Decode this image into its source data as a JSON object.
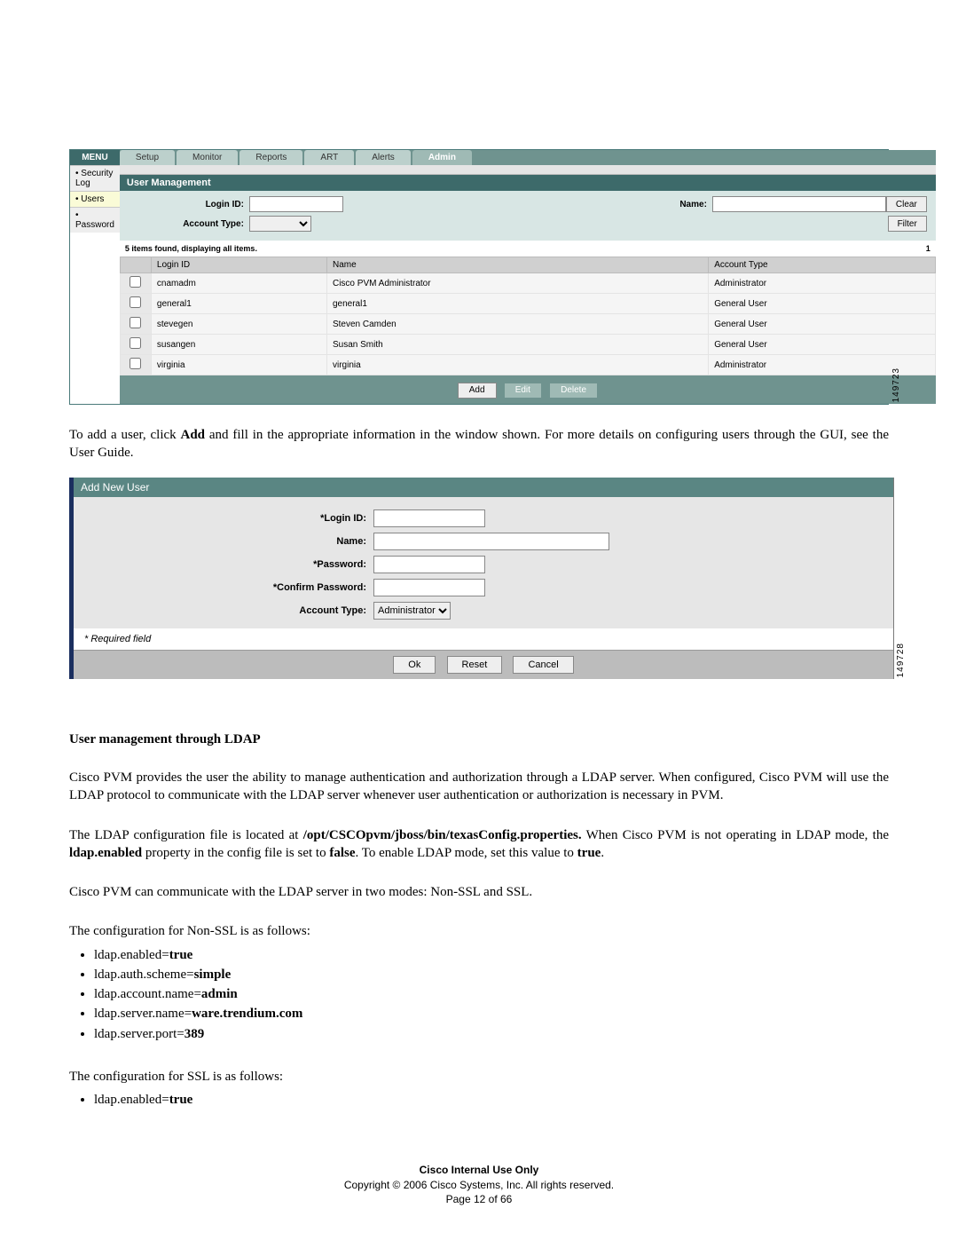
{
  "menu": {
    "header": "MENU",
    "items": [
      {
        "label": "Security Log",
        "selected": false
      },
      {
        "label": "Users",
        "selected": true
      },
      {
        "label": "Password",
        "selected": false
      }
    ]
  },
  "tabs": {
    "items": [
      "Setup",
      "Monitor",
      "Reports",
      "ART",
      "Alerts",
      "Admin"
    ],
    "active_index": 5
  },
  "user_mgmt": {
    "section_title": "User Management",
    "filters": {
      "login_id_label": "Login ID:",
      "name_label": "Name:",
      "account_type_label": "Account Type:",
      "clear_label": "Clear",
      "filter_label": "Filter"
    },
    "table": {
      "caption": "5 items found, displaying all items.",
      "page": "1",
      "cols": [
        "Login ID",
        "Name",
        "Account Type"
      ],
      "rows": [
        {
          "login": "cnamadm",
          "name": "Cisco PVM Administrator",
          "type": "Administrator"
        },
        {
          "login": "general1",
          "name": "general1",
          "type": "General User"
        },
        {
          "login": "stevegen",
          "name": "Steven Camden",
          "type": "General User"
        },
        {
          "login": "susangen",
          "name": "Susan Smith",
          "type": "General User"
        },
        {
          "login": "virginia",
          "name": "virginia",
          "type": "Administrator"
        }
      ]
    },
    "actions": {
      "add": "Add",
      "edit": "Edit",
      "delete": "Delete"
    },
    "image_id": "149723"
  },
  "body_text_1": "To add a user, click <b>Add</b> and fill in the appropriate information in the window shown. For more details on configuring users through the GUI, see the User Guide.",
  "add_user": {
    "title": "Add New User",
    "labels": {
      "login_id": "*Login ID:",
      "name": "Name:",
      "password": "*Password:",
      "confirm_password": "*Confirm Password:",
      "account_type": "Account Type:"
    },
    "account_type_value": "Administrator",
    "required_note": "* Required field",
    "buttons": {
      "ok": "Ok",
      "reset": "Reset",
      "cancel": "Cancel"
    },
    "image_id": "149728"
  },
  "ldap": {
    "heading": "User management through LDAP",
    "para1": "Cisco PVM provides the user the ability to manage authentication and authorization through a LDAP server. When configured, Cisco PVM will use the LDAP protocol to communicate with the LDAP server whenever user authentication or authorization is necessary in PVM.",
    "para2_a": "The LDAP configuration file is located at ",
    "para2_path": "/opt/CSCOpvm/jboss/bin/texasConfig.properties.",
    "para2_b": "  When Cisco PVM is not operating in LDAP mode, the ",
    "para2_prop": "ldap.enabled",
    "para2_c": " property in the config file is set to ",
    "para2_false": "false",
    "para2_d": ". To enable LDAP mode, set this value to ",
    "para2_true": "true",
    "para2_e": ".",
    "para3": "Cisco PVM can communicate with the LDAP server in two modes: Non-SSL and SSL.",
    "para4": "The configuration for Non-SSL is as follows:",
    "nonssl": [
      {
        "key": "ldap.enabled=",
        "val": "true"
      },
      {
        "key": "ldap.auth.scheme=",
        "val": "simple"
      },
      {
        "key": "ldap.account.name=",
        "val": "admin"
      },
      {
        "key": "ldap.server.name=",
        "val": "ware.trendium.com"
      },
      {
        "key": "ldap.server.port=",
        "val": "389"
      }
    ],
    "para5": "The configuration for SSL is as follows:",
    "ssl": [
      {
        "key": "ldap.enabled=",
        "val": "true"
      }
    ]
  },
  "footer": {
    "line1": "Cisco Internal Use Only",
    "line2": "Copyright © 2006 Cisco Systems, Inc. All rights reserved.",
    "line3": "Page 12 of 66"
  }
}
